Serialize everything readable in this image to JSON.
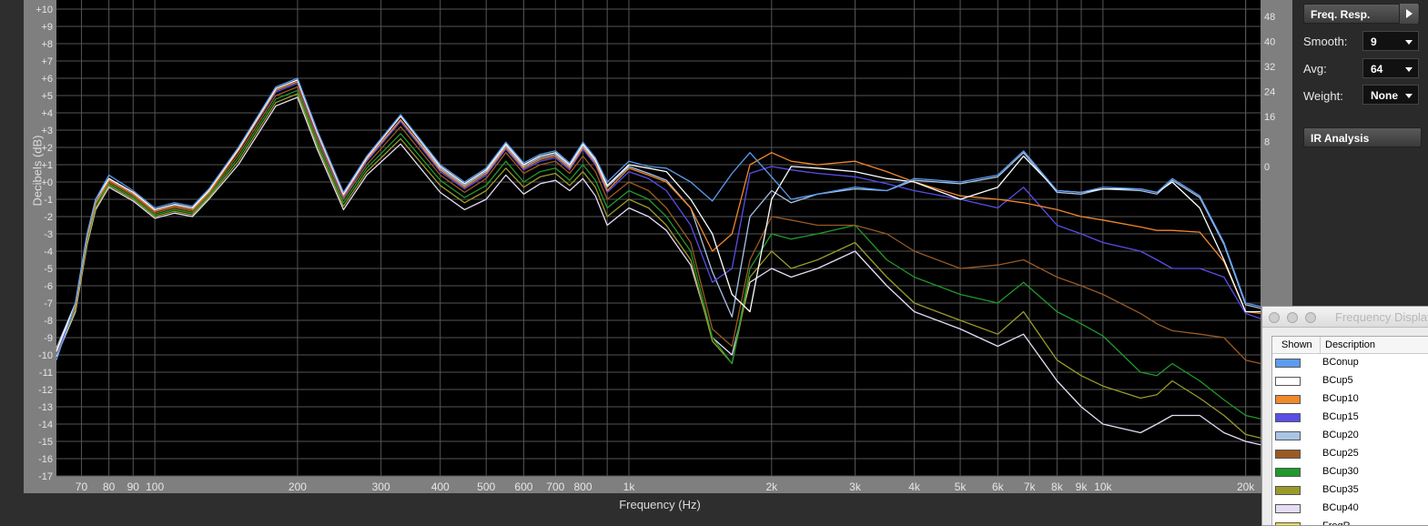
{
  "panel": {
    "freq_resp_label": "Freq. Resp.",
    "smooth_label": "Smooth:",
    "smooth_value": "9",
    "avg_label": "Avg:",
    "avg_value": "64",
    "weight_label": "Weight:",
    "weight_value": "None",
    "ir_analysis_label": "IR Analysis"
  },
  "legend_window": {
    "title": "Frequency Display",
    "col_shown": "Shown",
    "col_description": "Description",
    "items": [
      {
        "name": "BConup",
        "color": "#5b9bf0"
      },
      {
        "name": "BCup5",
        "color": "#ffffff"
      },
      {
        "name": "BCup10",
        "color": "#f0882c"
      },
      {
        "name": "BCup15",
        "color": "#5a4de8"
      },
      {
        "name": "BCup20",
        "color": "#a9c4e6"
      },
      {
        "name": "BCup25",
        "color": "#9a5a22"
      },
      {
        "name": "BCup30",
        "color": "#1f9a2a"
      },
      {
        "name": "BCup35",
        "color": "#9a9a2a"
      },
      {
        "name": "BCup40",
        "color": "#e6dcf6"
      },
      {
        "name": "FreqR",
        "color": "#f0e04a"
      }
    ]
  },
  "chart_data": {
    "type": "line",
    "xlabel": "Frequency (Hz)",
    "ylabel": "Decibels (dB)",
    "x_scale": "log",
    "xlim": [
      62,
      21500
    ],
    "ylim": [
      -17,
      10
    ],
    "grid": true,
    "x_ticks": [
      {
        "value": 70,
        "label": "70"
      },
      {
        "value": 80,
        "label": "80"
      },
      {
        "value": 90,
        "label": "90"
      },
      {
        "value": 100,
        "label": "100"
      },
      {
        "value": 200,
        "label": "200"
      },
      {
        "value": 300,
        "label": "300"
      },
      {
        "value": 400,
        "label": "400"
      },
      {
        "value": 500,
        "label": "500"
      },
      {
        "value": 600,
        "label": "600"
      },
      {
        "value": 700,
        "label": "700"
      },
      {
        "value": 800,
        "label": "800"
      },
      {
        "value": 1000,
        "label": "1k"
      },
      {
        "value": 2000,
        "label": "2k"
      },
      {
        "value": 3000,
        "label": "3k"
      },
      {
        "value": 4000,
        "label": "4k"
      },
      {
        "value": 5000,
        "label": "5k"
      },
      {
        "value": 6000,
        "label": "6k"
      },
      {
        "value": 7000,
        "label": "7k"
      },
      {
        "value": 8000,
        "label": "8k"
      },
      {
        "value": 9000,
        "label": "9k"
      },
      {
        "value": 10000,
        "label": "10k"
      },
      {
        "value": 20000,
        "label": "20k"
      }
    ],
    "y_ticks": [
      "+10",
      "+9",
      "+8",
      "+7",
      "+6",
      "+5",
      "+4",
      "+3",
      "+2",
      "+1",
      "+0",
      "-1",
      "-2",
      "-3",
      "-4",
      "-5",
      "-6",
      "-7",
      "-8",
      "-9",
      "-10",
      "-11",
      "-12",
      "-13",
      "-14",
      "-15",
      "-16",
      "-17"
    ],
    "y2_ticks": [
      "48",
      "40",
      "32",
      "24",
      "16",
      "8",
      "0"
    ],
    "x": [
      62,
      68,
      72,
      75,
      80,
      90,
      100,
      110,
      120,
      130,
      150,
      180,
      200,
      220,
      250,
      280,
      330,
      400,
      450,
      500,
      550,
      600,
      650,
      700,
      750,
      800,
      850,
      900,
      1000,
      1100,
      1200,
      1350,
      1500,
      1650,
      1800,
      2000,
      2200,
      2500,
      3000,
      3500,
      4000,
      5000,
      6000,
      6800,
      8000,
      9000,
      10000,
      12000,
      13000,
      14000,
      16000,
      18000,
      20000,
      21500
    ],
    "series": [
      {
        "name": "BConup",
        "color": "#5b9bf0",
        "values": [
          -10.3,
          -7,
          -3,
          -1,
          0.4,
          -0.5,
          -1.5,
          -1.2,
          -1.4,
          -0.4,
          2,
          5.5,
          6,
          3,
          -0.6,
          1.5,
          3.9,
          1,
          0,
          0.8,
          2.3,
          1.1,
          1.6,
          1.8,
          1.1,
          2.3,
          1.4,
          0,
          1.2,
          0.9,
          0.8,
          0,
          -1.1,
          0.5,
          1.7,
          0.3,
          -1,
          -0.7,
          -0.3,
          -0.5,
          0.2,
          0,
          0.4,
          1.8,
          -0.5,
          -0.6,
          -0.3,
          -0.4,
          -0.6,
          0.2,
          -0.8,
          -3.5,
          -7,
          -7.2
        ]
      },
      {
        "name": "BCup5",
        "color": "#ffffff",
        "values": [
          -9.8,
          -7,
          -3,
          -1,
          0.2,
          -0.6,
          -1.6,
          -1.3,
          -1.5,
          -0.5,
          1.9,
          5.4,
          5.9,
          2.9,
          -0.7,
          1.4,
          3.8,
          0.9,
          -0.1,
          0.7,
          2.2,
          1,
          1.5,
          1.7,
          1,
          2.2,
          1.3,
          -0.2,
          1,
          0.8,
          0.6,
          -1,
          -3,
          -6.5,
          -7.5,
          -1,
          0.9,
          0.8,
          0.6,
          0.2,
          0,
          -1,
          -0.3,
          1.5,
          -0.5,
          -0.6,
          -0.4,
          -0.4,
          -0.6,
          0,
          -1.5,
          -4.5,
          -7.5,
          -7.5
        ]
      },
      {
        "name": "BCup10",
        "color": "#f0882c",
        "values": [
          -9.7,
          -7.2,
          -3.2,
          -1.2,
          0.1,
          -0.7,
          -1.7,
          -1.4,
          -1.6,
          -0.6,
          1.8,
          5.3,
          5.8,
          2.8,
          -0.8,
          1.3,
          3.6,
          0.7,
          -0.3,
          0.5,
          2,
          0.8,
          1.3,
          1.5,
          0.8,
          2,
          1.1,
          -0.5,
          0.8,
          0.4,
          0,
          -1.5,
          -4,
          -3,
          1,
          1.7,
          1.2,
          1,
          1.2,
          0.6,
          0,
          -0.8,
          -1,
          -1.2,
          -1.6,
          -2,
          -2.2,
          -2.6,
          -2.8,
          -2.8,
          -2.9,
          -4.6,
          -7.5,
          -7.6
        ]
      },
      {
        "name": "BCup15",
        "color": "#5a4de8",
        "values": [
          -9.9,
          -7.1,
          -3.1,
          -1.1,
          0.1,
          -0.7,
          -1.7,
          -1.4,
          -1.6,
          -0.6,
          1.8,
          5.2,
          5.7,
          2.7,
          -0.9,
          1.2,
          3.5,
          0.6,
          -0.4,
          0.4,
          1.9,
          0.7,
          1.2,
          1.4,
          0.7,
          1.9,
          1,
          -0.6,
          0.6,
          0.2,
          -0.5,
          -2.5,
          -5.8,
          -5,
          0.5,
          0.9,
          0.7,
          0.5,
          0.3,
          -0.1,
          -0.5,
          -1,
          -1.5,
          -0.3,
          -2.5,
          -3,
          -3.5,
          -4,
          -4.5,
          -5,
          -5,
          -5.5,
          -7.6,
          -7.9
        ]
      },
      {
        "name": "BCup20",
        "color": "#a9c4e6",
        "values": [
          -9.6,
          -7,
          -3,
          -1,
          0.2,
          -0.6,
          -1.6,
          -1.3,
          -1.5,
          -0.5,
          1.8,
          5.3,
          5.8,
          2.8,
          -0.8,
          1.3,
          3.6,
          0.8,
          -0.2,
          0.6,
          2.1,
          0.9,
          1.4,
          1.6,
          0.9,
          2.1,
          1.2,
          -0.3,
          0.9,
          0.5,
          0.1,
          -1.5,
          -5.2,
          -7.8,
          -2,
          -0.5,
          -1.2,
          -0.7,
          -0.4,
          -0.5,
          0.1,
          -0.1,
          0.3,
          1.7,
          -0.6,
          -0.7,
          -0.4,
          -0.5,
          -0.7,
          0.1,
          -0.9,
          -3.6,
          -7.1,
          -7.3
        ]
      },
      {
        "name": "BCup25",
        "color": "#9a5a22",
        "values": [
          -9.7,
          -7.1,
          -3.2,
          -1.2,
          0,
          -0.8,
          -1.8,
          -1.5,
          -1.7,
          -0.7,
          1.6,
          5,
          5.5,
          2.5,
          -1,
          1,
          3.2,
          0.4,
          -0.6,
          0.2,
          1.7,
          0.5,
          1,
          1.2,
          0.5,
          1.5,
          0.6,
          -1,
          0,
          -0.5,
          -1.5,
          -3.5,
          -8.5,
          -9.5,
          -4.5,
          -2,
          -2.2,
          -2.5,
          -2.5,
          -3,
          -4,
          -5,
          -4.8,
          -4.5,
          -5.5,
          -6,
          -6.5,
          -7.6,
          -8.2,
          -8.6,
          -8.8,
          -9,
          -10.3,
          -10.5
        ]
      },
      {
        "name": "BCup30",
        "color": "#1f9a2a",
        "values": [
          -9.8,
          -7.2,
          -3.3,
          -1.3,
          -0.1,
          -0.9,
          -1.9,
          -1.6,
          -1.8,
          -0.8,
          1.4,
          4.8,
          5.3,
          2.3,
          -1.2,
          0.8,
          2.8,
          0.1,
          -0.9,
          -0.2,
          1.2,
          0,
          0.6,
          0.8,
          0.1,
          1,
          0.1,
          -1.5,
          -0.5,
          -1,
          -2,
          -4,
          -9,
          -10.5,
          -5,
          -3,
          -3.3,
          -3,
          -2.5,
          -4.5,
          -5.5,
          -6.5,
          -7,
          -5.8,
          -7.5,
          -8.2,
          -8.9,
          -11,
          -11.2,
          -10.5,
          -11.5,
          -12.6,
          -13.5,
          -13.7
        ]
      },
      {
        "name": "BCup35",
        "color": "#9a9a2a",
        "values": [
          -10,
          -7.4,
          -3.5,
          -1.5,
          -0.2,
          -1,
          -2,
          -1.7,
          -1.9,
          -0.9,
          1.2,
          4.6,
          5.1,
          2.1,
          -1.4,
          0.6,
          2.5,
          -0.2,
          -1.2,
          -0.5,
          0.8,
          -0.3,
          0.3,
          0.5,
          -0.2,
          0.6,
          -0.3,
          -2,
          -1,
          -1.5,
          -2.5,
          -4.5,
          -9.2,
          -10.5,
          -5.5,
          -4,
          -5,
          -4.5,
          -3.5,
          -5.5,
          -7,
          -8,
          -8.8,
          -7.5,
          -10.3,
          -11.2,
          -11.8,
          -12.5,
          -12.3,
          -11.5,
          -12.5,
          -13.5,
          -14.6,
          -14.8
        ]
      },
      {
        "name": "BCup40",
        "color": "#e6dcf6",
        "values": [
          -10.1,
          -7.5,
          -3.6,
          -1.6,
          -0.3,
          -1.1,
          -2.1,
          -1.8,
          -2,
          -1,
          1,
          4.4,
          4.9,
          1.9,
          -1.6,
          0.4,
          2.2,
          -0.6,
          -1.6,
          -1,
          0.4,
          -0.7,
          -0.1,
          0.1,
          -0.5,
          0.2,
          -0.8,
          -2.5,
          -1.5,
          -2,
          -2.8,
          -4.8,
          -9,
          -10,
          -5.8,
          -5,
          -5.5,
          -5,
          -4,
          -6,
          -7.5,
          -8.5,
          -9.5,
          -8.8,
          -11.5,
          -13,
          -14,
          -14.5,
          -14,
          -13.5,
          -13.5,
          -14.5,
          -15,
          -15.2
        ]
      }
    ]
  }
}
